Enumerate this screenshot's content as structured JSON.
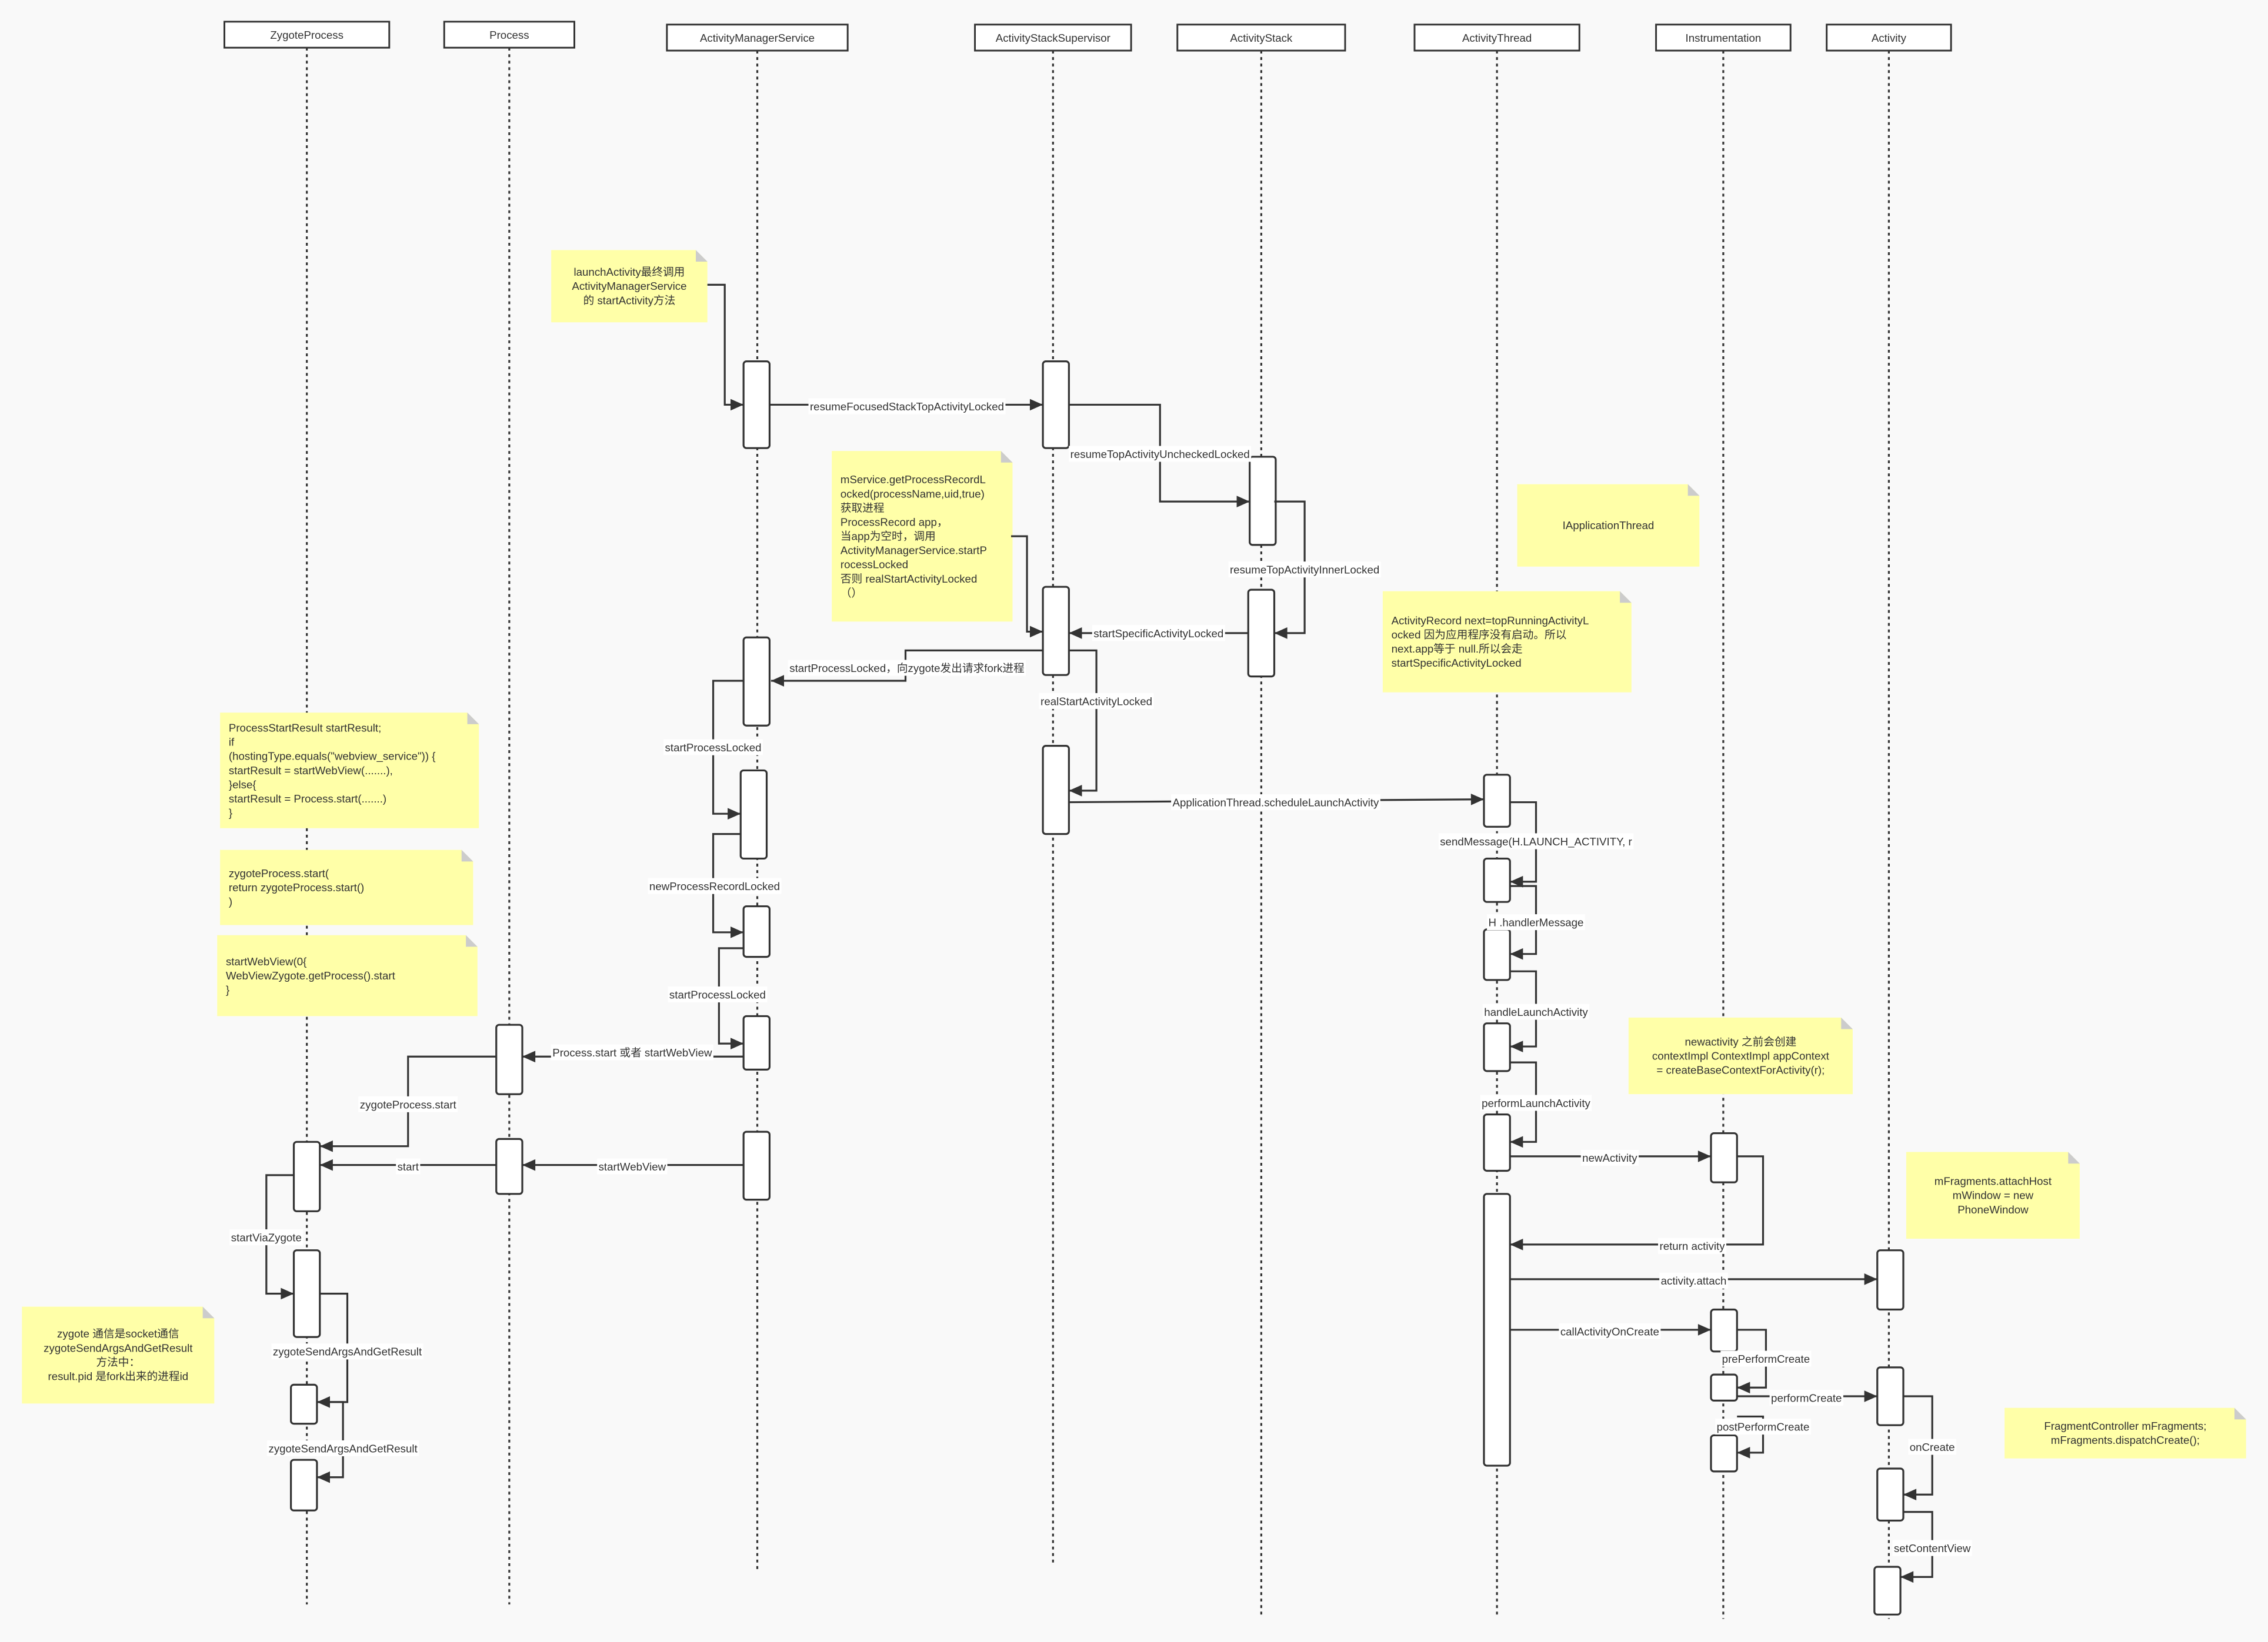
{
  "participants": [
    {
      "name": "ZygoteProcess"
    },
    {
      "name": "Process"
    },
    {
      "name": "ActivityManagerService"
    },
    {
      "name": "ActivityStackSupervisor"
    },
    {
      "name": "ActivityStack"
    },
    {
      "name": "ActivityThread"
    },
    {
      "name": "Instrumentation"
    },
    {
      "name": "Activity"
    }
  ],
  "messages": [
    {
      "label": ""
    },
    {
      "label": "resumeFocusedStackTopActivityLocked"
    },
    {
      "label": "resumeTopActivityUncheckedLocked"
    },
    {
      "label": "resumeTopActivityInnerLocked"
    },
    {
      "label": "startSpecificActivityLocked"
    },
    {
      "label": ""
    },
    {
      "label": "startProcessLocked，向zygote发出请求fork进程"
    },
    {
      "label": "realStartActivityLocked"
    },
    {
      "label": "ApplicationThread.scheduleLaunchActivity"
    },
    {
      "label": "sendMessage(H.LAUNCH_ACTIVITY, r"
    },
    {
      "label": "H .handlerMessage"
    },
    {
      "label": "handleLaunchActivity"
    },
    {
      "label": "performLaunchActivity"
    },
    {
      "label": "newActivity"
    },
    {
      "label": "return activity"
    },
    {
      "label": "activity.attach"
    },
    {
      "label": "callActivityOnCreate"
    },
    {
      "label": "prePerformCreate"
    },
    {
      "label": "performCreate"
    },
    {
      "label": "postPerformCreate"
    },
    {
      "label": "onCreate"
    },
    {
      "label": "setContentView"
    },
    {
      "label": "startProcessLocked"
    },
    {
      "label": "newProcessRecordLocked"
    },
    {
      "label": "startProcessLocked"
    },
    {
      "label": "Process.start 或者 startWebView"
    },
    {
      "label": "zygoteProcess.start"
    },
    {
      "label": "start"
    },
    {
      "label": "startWebView"
    },
    {
      "label": "startViaZygote"
    },
    {
      "label": "zygoteSendArgsAndGetResult"
    },
    {
      "label": "zygoteSendArgsAndGetResult"
    }
  ],
  "notes": [
    {
      "lines": [
        "launchActivity最终调用",
        "ActivityManagerService",
        "的 startActivity方法"
      ]
    },
    {
      "lines": [
        "mService.getProcessRecordL",
        "ocked(processName,uid,true)",
        "获取进程",
        "ProcessRecord  app，",
        "当app为空时，调用",
        "ActivityManagerService.startP",
        "rocessLocked",
        "否则 realStartActivityLocked",
        "（）"
      ]
    },
    {
      "lines": [
        "IApplicationThread"
      ]
    },
    {
      "lines": [
        "ActivityRecord  next=topRunningActivityL",
        "ocked  因为应用程序没有启动。所以",
        "next.app等于 null.所以会走",
        "startSpecificActivityLocked"
      ]
    },
    {
      "lines": [
        "  ProcessStartResult startResult;",
        "    if",
        "(hostingType.equals(\"webview_service\")) {",
        " startResult = startWebView(.......),",
        "}else{",
        " startResult = Process.start(.......)",
        "}"
      ]
    },
    {
      "lines": [
        " zygoteProcess.start(",
        " return zygoteProcess.start()",
        ")"
      ]
    },
    {
      "lines": [
        "startWebView(0{",
        "WebViewZygote.getProcess().start",
        "}"
      ]
    },
    {
      "lines": [
        "newactivity 之前会创建",
        "contextImpl ContextImpl appContext",
        "= createBaseContextForActivity(r);"
      ]
    },
    {
      "lines": [
        "mFragments.attachHost",
        "mWindow = new",
        "PhoneWindow"
      ]
    },
    {
      "lines": [
        "FragmentController mFragments;",
        "mFragments.dispatchCreate();"
      ]
    },
    {
      "lines": [
        "zygote 通信是socket通信",
        "zygoteSendArgsAndGetResult",
        "方法中：",
        "result.pid 是fork出来的进程id"
      ]
    }
  ],
  "colors": {
    "background": "#f9f9f9",
    "line": "#333333",
    "note_fill": "#ffffa8",
    "note_fold": "#cccccc",
    "box_fill": "#ffffff"
  }
}
